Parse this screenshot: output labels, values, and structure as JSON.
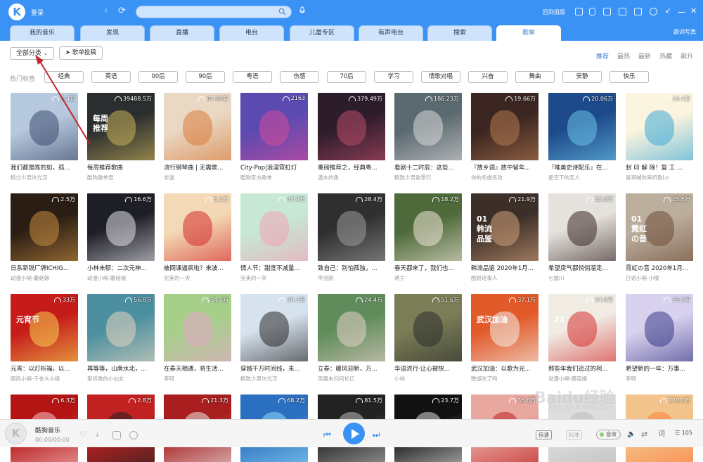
{
  "header": {
    "login": "登录",
    "retro": "回到旧版",
    "search_placeholder": ""
  },
  "tabs": [
    {
      "label": "我的音乐",
      "left": 0
    },
    {
      "label": "发现"
    },
    {
      "label": "直播"
    },
    {
      "label": "电台"
    },
    {
      "label": "儿童专区"
    },
    {
      "label": "有声电台"
    },
    {
      "label": "搜索"
    },
    {
      "label": "歌单",
      "active": true
    }
  ],
  "lyrics_label": "歌词写真",
  "toolbar": {
    "filter": "全部分类",
    "submit": "歌单投稿"
  },
  "sorts": [
    "推荐",
    "最热",
    "最新",
    "热藏",
    "飙升"
  ],
  "hot_label": "热门标签",
  "tags": [
    "经典",
    "英语",
    "00后",
    "90后",
    "粤语",
    "伤感",
    "70后",
    "学习",
    "情歌对唱",
    "兴奋",
    "舞曲",
    "安静",
    "快乐"
  ],
  "playlists": [
    {
      "count": "1.4万",
      "title": "我们都是陈的如，孤...",
      "author": "精分少男许光汉",
      "color": "#b7c9de",
      "accent": "#3d4b6d"
    },
    {
      "count": "39488.5万",
      "title": "每周推荐歌曲",
      "author": "酷狗歌单君",
      "color": "#2b2e2f",
      "accent": "#c9b25a",
      "overlay": "每周\n推荐"
    },
    {
      "count": "67.86万",
      "title": "流行钢琴曲 | 无需歌...",
      "author": "非迷",
      "color": "#e9d8c4",
      "accent": "#d87b3a"
    },
    {
      "count": "2163",
      "title": "City-Pop|浪漫霓虹灯",
      "author": "酷狗官方歌单",
      "color": "#5b4ab0",
      "accent": "#d64b9a"
    },
    {
      "count": "379.49万",
      "title": "重磅推荐之，经典粤...",
      "author": "温水的鱼",
      "color": "#2d1c2a",
      "accent": "#b84c6a"
    },
    {
      "count": "186.23万",
      "title": "看剧十二时辰：这些...",
      "author": "精致少男谢景行",
      "color": "#5b6970",
      "accent": "#d8d8d8"
    },
    {
      "count": "19.66万",
      "title": "『故乡调』故中留年...",
      "author": "你的冬虞名攻",
      "color": "#3a2520",
      "accent": "#b57a50"
    },
    {
      "count": "20.06万",
      "title": "『唯美史诗配乐』在...",
      "author": "星空下的恋人",
      "color": "#1d4a8a",
      "accent": "#6cc3e8"
    },
    {
      "count": "13.4万",
      "title": "封 印 解 除！复 工 ...",
      "author": "喜哥喊你来听歌Lo",
      "color": "#fbf4df",
      "accent": "#3ea9d6"
    },
    {
      "count": "2.5万",
      "title": "日系新锐厂牌ICHIG...",
      "author": "动漫小嗝-蘑菇娘",
      "color": "#2a1d14",
      "accent": "#c78d3f"
    },
    {
      "count": "16.6万",
      "title": "小林未郁：二次元神...",
      "author": "动漫小嗝-蘑菇娘",
      "color": "#1e1e26",
      "accent": "#e2e2e8"
    },
    {
      "count": "5.1万",
      "title": "被网课逼疯啦？来波...",
      "author": "完美的一天",
      "color": "#f3d9b5",
      "accent": "#d42b2b"
    },
    {
      "count": "47.9万",
      "title": "情人节：甜度不减量...",
      "author": "完美的一天",
      "color": "#c6e8d5",
      "accent": "#f2a3b8"
    },
    {
      "count": "28.4万",
      "title": "致自己：别怕孤独，...",
      "author": "李羽航",
      "color": "#2f2f2f",
      "accent": "#9a9a9a"
    },
    {
      "count": "18.2万",
      "title": "春天都来了，我们也...",
      "author": "诱宁",
      "color": "#4e6a3a",
      "accent": "#f0e6d8"
    },
    {
      "count": "21.9万",
      "title": "韩流品鉴 2020年1月...",
      "author": "酷耐话事人",
      "color": "#3c2f28",
      "accent": "#d2a07a",
      "overlay": "01\n韩流\n品鉴"
    },
    {
      "count": "52.8万",
      "title": "希望戾气都悄悄溜走...",
      "author": "七瑟川",
      "color": "#e5e1dc",
      "accent": "#3a2a2a"
    },
    {
      "count": "15.6万",
      "title": "霓虹の音 2020年1月...",
      "author": "日语小嗝-小樱",
      "color": "#bcae9c",
      "accent": "#6e4d3a",
      "overlay": "01\n霓虹\nの音"
    },
    {
      "count": "33万",
      "title": "元宵：以灯析福，以...",
      "author": "国风小嗝-千金大小姐",
      "color": "#c51c1a",
      "accent": "#f5d050",
      "overlay": "元宵节"
    },
    {
      "count": "56.8万",
      "title": "再等等，山南水北，...",
      "author": "爱听歌的小仙女",
      "color": "#4b8fa0",
      "accent": "#e7d6c0"
    },
    {
      "count": "34.8万",
      "title": "在春天相遇，将生活...",
      "author": "李呀",
      "color": "#a6cf8a",
      "accent": "#e4a8c8"
    },
    {
      "count": "28.3万",
      "title": "穿越千万时间线，未...",
      "author": "精致少男许光汉",
      "color": "#d6e2ee",
      "accent": "#2a2a2a"
    },
    {
      "count": "24.4万",
      "title": "立春：暖风迎新，万...",
      "author": "凤凰未归何长亿",
      "color": "#5f8c5a",
      "accent": "#e6cfc8"
    },
    {
      "count": "51.6万",
      "title": "华语流行·让心被快...",
      "author": "小林",
      "color": "#7a7d55",
      "accent": "#2e2e2e"
    },
    {
      "count": "37.1万",
      "title": "武汉加油：以歌为光...",
      "author": "晚饭吃了吗",
      "color": "#e25a2a",
      "accent": "#f3efe8",
      "overlay": "武汉加油"
    },
    {
      "count": "24.9万",
      "title": "那些年我们追过的柯...",
      "author": "动漫小嗝-蘑菇娘",
      "color": "#f0ece4",
      "accent": "#d73232",
      "overlay": "21"
    },
    {
      "count": "23.1万",
      "title": "希望新的一年：万事...",
      "author": "李呀",
      "color": "#d9d2ee",
      "accent": "#3a3a88"
    },
    {
      "count": "6.3万",
      "title": "",
      "author": "",
      "color": "#b51414",
      "accent": "#f5c0c0"
    },
    {
      "count": "2.8万",
      "title": "",
      "author": "",
      "color": "#c22121",
      "accent": "#222"
    },
    {
      "count": "21.3万",
      "title": "",
      "author": "",
      "color": "#a81d1d",
      "accent": "#e8e8e8"
    },
    {
      "count": "68.2万",
      "title": "",
      "author": "",
      "color": "#2a6fc0",
      "accent": "#8fd8f8"
    },
    {
      "count": "81.5万",
      "title": "",
      "author": "",
      "color": "#222",
      "accent": "#bbb"
    },
    {
      "count": "23.7万",
      "title": "",
      "author": "",
      "color": "#111",
      "accent": "#ddd"
    },
    {
      "count": "36.6万",
      "title": "",
      "author": "",
      "color": "#e8a8a0",
      "accent": "#c02020"
    },
    {
      "count": "",
      "title": "",
      "author": "",
      "color": "#ddd",
      "accent": "#bbb"
    },
    {
      "count": "178.1万",
      "title": "",
      "author": "",
      "color": "#f2c38a",
      "accent": "#ff8040"
    }
  ],
  "player": {
    "song": "酷狗音乐",
    "time": "00:00/00:00",
    "speed": "倍速",
    "quality": "标准",
    "effect": "音效",
    "queue": "105"
  },
  "watermark": {
    "main": "Baidu经验",
    "sub": "jingyan.baidu.com"
  }
}
